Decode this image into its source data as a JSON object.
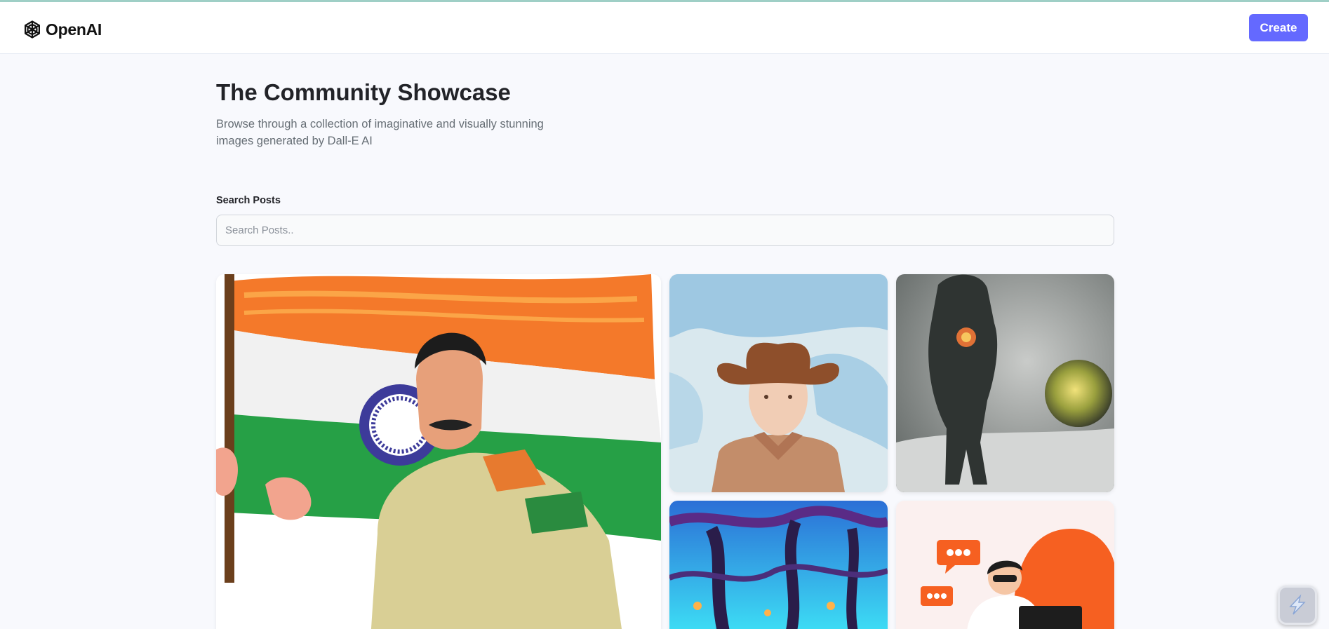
{
  "header": {
    "logo_text": "OpenAI",
    "logo_icon": "openai-logo-icon",
    "create_label": "Create"
  },
  "main": {
    "title": "The Community Showcase",
    "subtitle": "Browse through a collection of imaginative and visually stunning images generated by Dall-E AI"
  },
  "search": {
    "label": "Search Posts",
    "placeholder": "Search Posts..",
    "value": ""
  },
  "gallery": {
    "items": [
      {
        "subject": "man-with-indian-flag"
      },
      {
        "subject": "watercolor-cowboy-boy"
      },
      {
        "subject": "astronaut-walking-toward-planet"
      },
      {
        "subject": "neon-alien-forest"
      },
      {
        "subject": "man-at-computer-chat-bubbles"
      }
    ]
  },
  "widget": {
    "icon": "lightning-bolt-icon"
  },
  "colors": {
    "accent": "#6469ff",
    "background": "#f8f9fd",
    "title": "#222328",
    "subtitle": "#666e75"
  }
}
